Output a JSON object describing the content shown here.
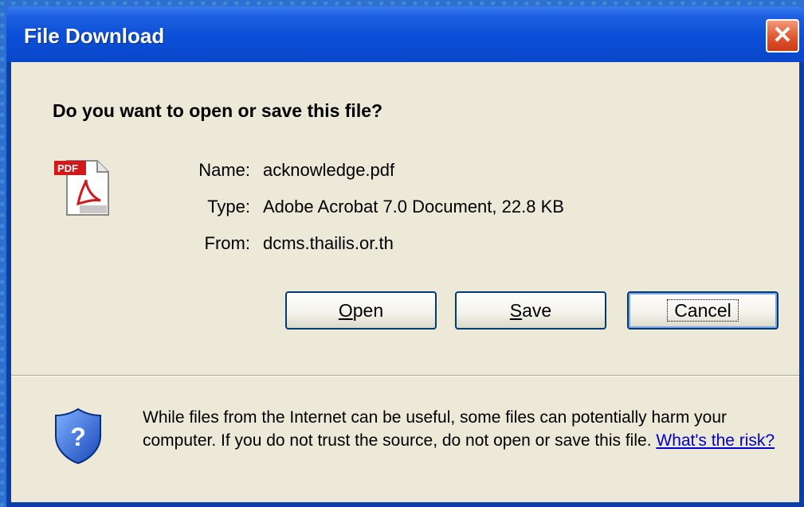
{
  "window": {
    "title": "File Download",
    "close_label": "✕"
  },
  "dialog": {
    "question": "Do you want to open or save this file?",
    "file_icon": "pdf-file-icon",
    "info": {
      "name_label": "Name:",
      "name_value": "acknowledge.pdf",
      "type_label": "Type:",
      "type_value": "Adobe Acrobat 7.0 Document, 22.8 KB",
      "from_label": "From:",
      "from_value": "dcms.thailis.or.th"
    },
    "buttons": {
      "open_accel": "O",
      "open_rest": "pen",
      "save_accel": "S",
      "save_rest": "ave",
      "cancel": "Cancel"
    },
    "warning": {
      "icon": "shield-question-icon",
      "text": "While files from the Internet can be useful, some files can potentially harm your computer. If you do not trust the source, do not open or save this file.",
      "link": "What's the risk?"
    }
  }
}
